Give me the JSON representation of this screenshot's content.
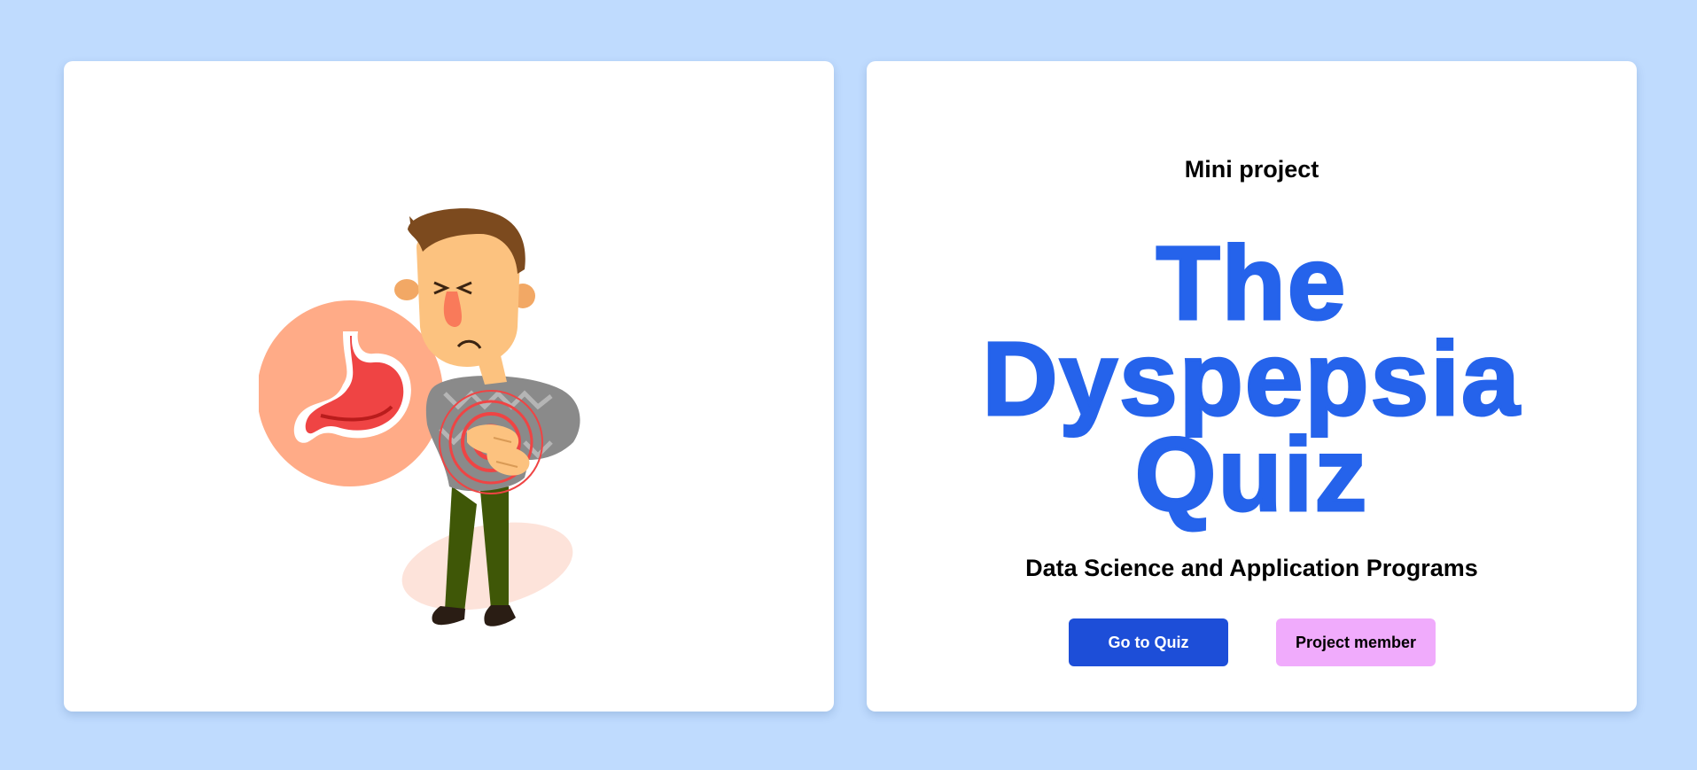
{
  "page": {
    "background_color": "#bfdbfe"
  },
  "left_card": {
    "illustration": {
      "icon": "man-with-stomach-ache-illustration",
      "colors": {
        "stomach_circle": "#ffab87",
        "stomach": "#ef4444",
        "pain_rings": "#ef4444",
        "hair": "#7c4a1e",
        "skin": "#fcc27f",
        "sweater": "#8a8a8a",
        "pants": "#3f5707",
        "shadow": "#fde3da"
      }
    }
  },
  "right_card": {
    "subtitle": "Mini project",
    "title_lines": [
      "The",
      "Dyspepsia",
      "Quiz"
    ],
    "program": "Data Science and Application Programs",
    "buttons": {
      "quiz_label": "Go to Quiz",
      "member_label": "Project member"
    },
    "colors": {
      "title": "#2563eb",
      "quiz_button": "#1d4ed8",
      "member_button": "#f0abfc"
    }
  }
}
